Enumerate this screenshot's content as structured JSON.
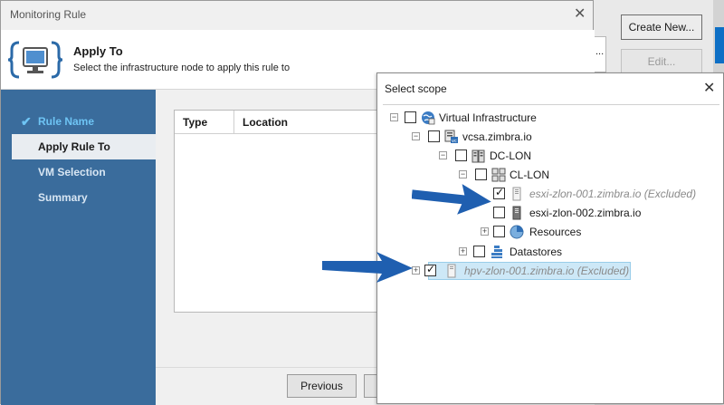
{
  "background": {
    "create_new_label": "Create New...",
    "edit_label": "Edit...",
    "field_text": "..."
  },
  "main_window": {
    "title": "Monitoring Rule",
    "close_glyph": "✕",
    "header": {
      "title": "Apply To",
      "subtitle": "Select the infrastructure node to apply this rule to",
      "icon": "monitor-braces-icon"
    },
    "steps": [
      {
        "label": "Rule Name",
        "state": "done"
      },
      {
        "label": "Apply Rule To",
        "state": "active"
      },
      {
        "label": "VM Selection",
        "state": "pending"
      },
      {
        "label": "Summary",
        "state": "pending"
      }
    ],
    "table": {
      "columns": [
        "Type",
        "Location"
      ]
    },
    "buttons": {
      "previous": "Previous"
    }
  },
  "scope_dialog": {
    "title": "Select scope",
    "close_glyph": "✕",
    "tree": [
      {
        "label": "Virtual Infrastructure",
        "expander": "−",
        "checked": false,
        "icon": "globe-icon",
        "excluded": false
      },
      {
        "label": "vcsa.zimbra.io",
        "expander": "−",
        "checked": false,
        "icon": "vcenter-icon",
        "excluded": false
      },
      {
        "label": "DC-LON",
        "expander": "−",
        "checked": false,
        "icon": "datacenter-icon",
        "excluded": false
      },
      {
        "label": "CL-LON",
        "expander": "−",
        "checked": false,
        "icon": "cluster-icon",
        "excluded": false
      },
      {
        "label": "esxi-zlon-001.zimbra.io (Excluded)",
        "expander": "",
        "checked": true,
        "icon": "host-icon",
        "excluded": true
      },
      {
        "label": "esxi-zlon-002.zimbra.io",
        "expander": "",
        "checked": false,
        "icon": "host-icon",
        "excluded": false
      },
      {
        "label": "Resources",
        "expander": "+",
        "checked": false,
        "icon": "resource-pool-icon",
        "excluded": false
      },
      {
        "label": "Datastores",
        "expander": "+",
        "checked": false,
        "icon": "datastores-icon",
        "excluded": false
      },
      {
        "label": "hpv-zlon-001.zimbra.io (Excluded)",
        "expander": "+",
        "checked": true,
        "icon": "host-icon",
        "excluded": true
      }
    ]
  },
  "colors": {
    "sidebar": "#3a6c9c",
    "done_step": "#6ec4f4",
    "arrow": "#1f5fb0",
    "selection_highlight": "#cde8f7"
  }
}
